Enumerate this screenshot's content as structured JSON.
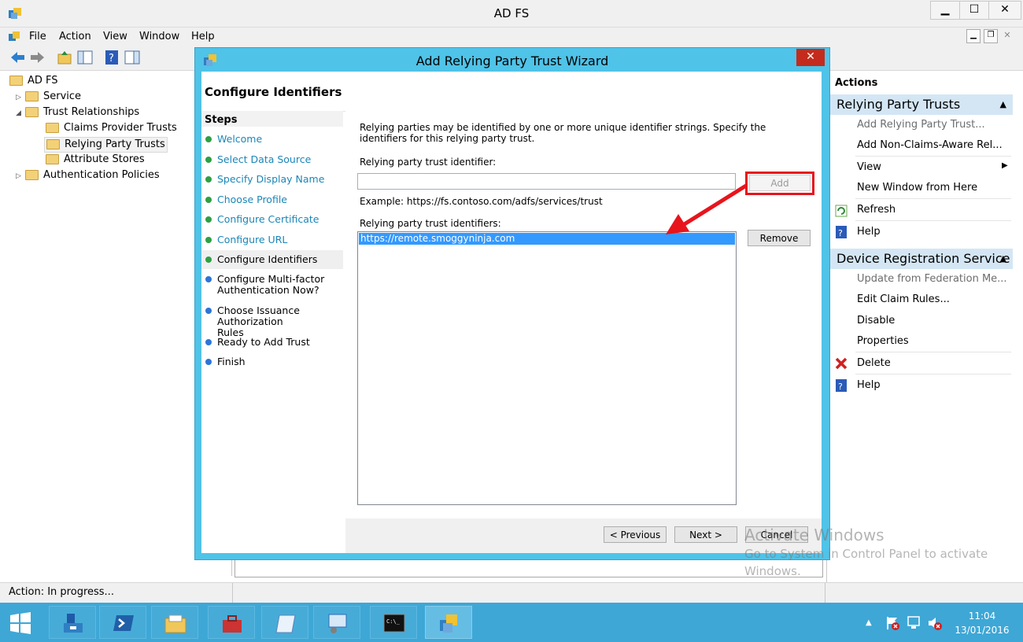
{
  "window": {
    "title": "AD FS"
  },
  "menu": [
    "File",
    "Action",
    "View",
    "Window",
    "Help"
  ],
  "tree": {
    "root": "AD FS",
    "items": [
      "Service",
      "Trust Relationships",
      "Claims Provider Trusts",
      "Relying Party Trusts",
      "Attribute Stores",
      "Authentication Policies"
    ]
  },
  "actions": {
    "title": "Actions",
    "section1": "Relying Party Trusts",
    "section1_items": [
      "Add Relying Party Trust...",
      "Add Non-Claims-Aware Rel...",
      "View",
      "New Window from Here",
      "Refresh",
      "Help"
    ],
    "section2": "Device Registration Service",
    "section2_items": [
      "Update from Federation Me...",
      "Edit Claim Rules...",
      "Disable",
      "Properties",
      "Delete",
      "Help"
    ]
  },
  "status": "Action:  In progress...",
  "dialog": {
    "title": "Add Relying Party Trust Wizard",
    "heading": "Configure Identifiers",
    "steps_title": "Steps",
    "steps": [
      "Welcome",
      "Select Data Source",
      "Specify Display Name",
      "Choose Profile",
      "Configure Certificate",
      "Configure URL",
      "Configure Identifiers",
      "Configure Multi-factor Authentication Now?",
      "Choose Issuance Authorization Rules",
      "Ready to Add Trust",
      "Finish"
    ],
    "description": "Relying parties may be identified by one or more unique identifier strings. Specify the identifiers for this relying party trust.",
    "identifier_label": "Relying party trust identifier:",
    "identifier_value": "",
    "add_label": "Add",
    "example": "Example: https://fs.contoso.com/adfs/services/trust",
    "identifiers_label": "Relying party trust identifiers:",
    "identifiers": [
      "https://remote.smoggyninja.com"
    ],
    "remove_label": "Remove",
    "prev_label": "< Previous",
    "next_label": "Next >",
    "cancel_label": "Cancel"
  },
  "watermark": {
    "line1": "Activate Windows",
    "line2": "Go to System in Control Panel to activate",
    "line3": "Windows."
  },
  "taskbar": {
    "time": "11:04",
    "date": "13/01/2016"
  },
  "colors": {
    "accent": "#4fc3e8",
    "taskbar": "#3ea7d6",
    "annotation": "#e8141c",
    "selection": "#3399ff"
  }
}
